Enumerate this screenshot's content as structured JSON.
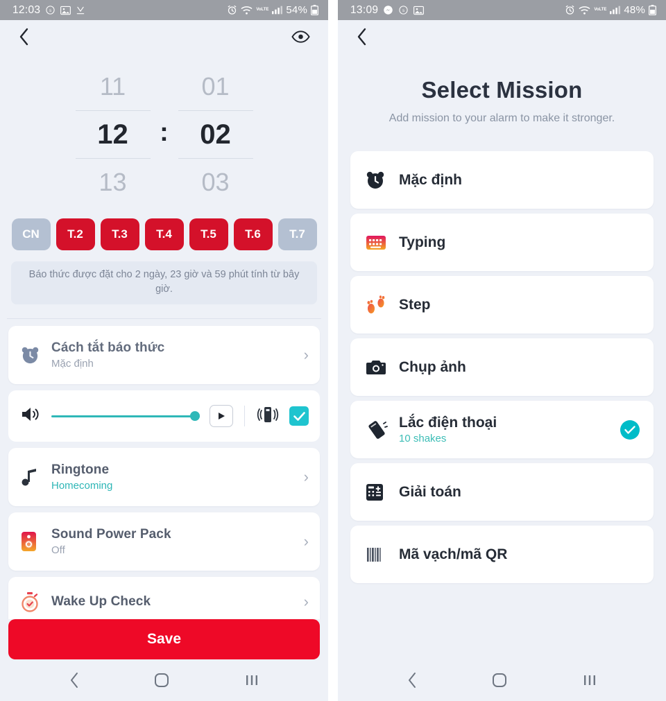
{
  "left": {
    "status_bar": {
      "time": "12:03",
      "battery_percent": "54%",
      "icons": [
        "sound-off-icon",
        "photo-icon",
        "download-icon",
        "alarm-icon",
        "wifi-icon",
        "volte-icon",
        "signal-icon",
        "battery-icon"
      ],
      "network_label": "VoLTE"
    },
    "topbar": {
      "back_icon": "chevron-left-icon",
      "preview_icon": "eye-icon"
    },
    "time_picker": {
      "hour_prev": "11",
      "hour_selected": "12",
      "hour_next": "13",
      "separator": ":",
      "minute_prev": "01",
      "minute_selected": "02",
      "minute_next": "03"
    },
    "days": [
      {
        "label": "CN",
        "selected": false
      },
      {
        "label": "T.2",
        "selected": true
      },
      {
        "label": "T.3",
        "selected": true
      },
      {
        "label": "T.4",
        "selected": true
      },
      {
        "label": "T.5",
        "selected": true
      },
      {
        "label": "T.6",
        "selected": true
      },
      {
        "label": "T.7",
        "selected": false
      }
    ],
    "info_text": "Báo thức được đặt cho 2 ngày, 23 giờ và 59 phút tính từ bây giờ.",
    "rows": [
      {
        "title": "Cách tắt báo thức",
        "subtitle": "Mặc định",
        "icon": "bear-clock-icon",
        "chevron": "›"
      },
      {
        "title": "Ringtone",
        "subtitle": "Homecoming",
        "icon": "music-note-icon",
        "chevron": "›"
      },
      {
        "title": "Sound Power Pack",
        "subtitle": "Off",
        "icon": "speaker-icon",
        "chevron": "›"
      },
      {
        "title": "Wake Up Check",
        "subtitle": "",
        "icon": "stopwatch-icon",
        "chevron": "›"
      }
    ],
    "volume_row": {
      "speaker_icon": "volume-up-icon",
      "slider_value": "100",
      "play_icon": "play-icon",
      "vibration_icon": "vibrate-icon",
      "vibration_checked": true
    },
    "save_label": "Save",
    "navbar": {
      "back": "‹",
      "home": "home-icon",
      "recents": "|||"
    }
  },
  "right": {
    "status_bar": {
      "time": "13:09",
      "battery_percent": "48%",
      "icons": [
        "messenger-icon",
        "sound-off-icon",
        "photo-icon",
        "alarm-icon",
        "wifi-icon",
        "volte-icon",
        "signal-icon",
        "battery-icon"
      ],
      "network_label": "VoLTE"
    },
    "topbar": {
      "back_icon": "chevron-left-icon"
    },
    "title": "Select Mission",
    "subtitle": "Add mission to your alarm to make it stronger.",
    "missions": [
      {
        "title": "Mặc định",
        "subtitle": "",
        "icon": "bear-clock-icon",
        "selected": false
      },
      {
        "title": "Typing",
        "subtitle": "",
        "icon": "keyboard-icon",
        "selected": false
      },
      {
        "title": "Step",
        "subtitle": "",
        "icon": "footprints-icon",
        "selected": false
      },
      {
        "title": "Chụp ảnh",
        "subtitle": "",
        "icon": "camera-icon",
        "selected": false
      },
      {
        "title": "Lắc điện thoại",
        "subtitle": "10 shakes",
        "icon": "shake-phone-icon",
        "selected": true
      },
      {
        "title": "Giải toán",
        "subtitle": "",
        "icon": "calculator-icon",
        "selected": false
      },
      {
        "title": "Mã vạch/mã QR",
        "subtitle": "",
        "icon": "barcode-icon",
        "selected": false
      }
    ],
    "navbar": {
      "back": "‹",
      "home": "home-icon",
      "recents": "|||"
    }
  },
  "colors": {
    "accent_red": "#d4112a",
    "save_red": "#ee0927",
    "teal": "#2fb8b8",
    "check_teal": "#00bcc8",
    "bg": "#eef1f7",
    "statusbar": "#9b9ea4"
  }
}
